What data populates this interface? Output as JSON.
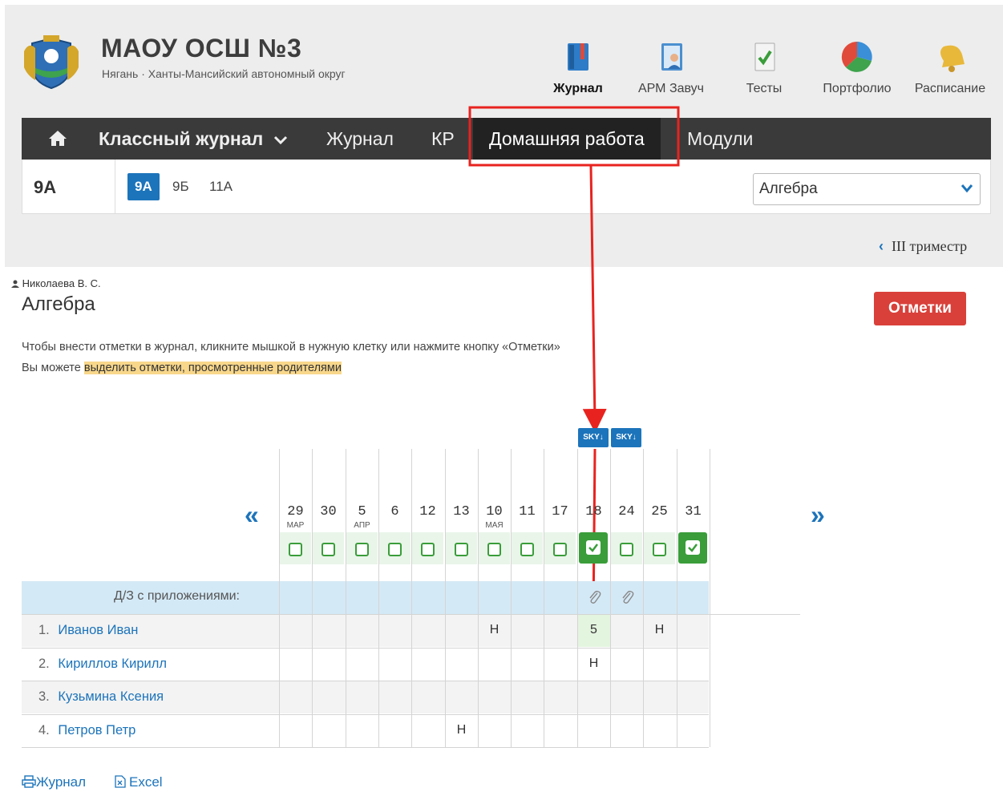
{
  "school": {
    "name": "МАОУ ОСШ №3",
    "subtitle": "Нягань · Ханты-Мансийский автономный округ"
  },
  "topnav": [
    {
      "label": "Журнал",
      "icon": "journal-icon",
      "active": true
    },
    {
      "label": "АРМ Завуч",
      "icon": "deputy-icon"
    },
    {
      "label": "Тесты",
      "icon": "tests-icon"
    },
    {
      "label": "Портфолио",
      "icon": "portfolio-icon"
    },
    {
      "label": "Расписание",
      "icon": "bell-icon"
    }
  ],
  "menu": {
    "home_icon": "home-icon",
    "class_journal": "Классный журнал",
    "journal": "Журнал",
    "kr": "КР",
    "homework": "Домашняя работа",
    "modules": "Модули"
  },
  "classbar": {
    "current": "9А",
    "classes": [
      "9А",
      "9Б",
      "11А"
    ],
    "subject": "Алгебра"
  },
  "term": "III триместр",
  "content": {
    "teacher": "Николаева В. С.",
    "title": "Алгебра",
    "marks_button": "Отметки",
    "hint1": "Чтобы внести отметки в журнал, кликните мышкой в нужную клетку или нажмите кнопку «Отметки»",
    "hint2_prefix": "Вы можете ",
    "hint2_link": "выделить отметки, просмотренные родителями"
  },
  "grid": {
    "sky_label": "SKY↓",
    "attach_label": "Д/З с приложениями:",
    "dates": [
      {
        "day": "29",
        "month": "МАР"
      },
      {
        "day": "30",
        "month": ""
      },
      {
        "day": "5",
        "month": "АПР"
      },
      {
        "day": "6",
        "month": ""
      },
      {
        "day": "12",
        "month": ""
      },
      {
        "day": "13",
        "month": ""
      },
      {
        "day": "10",
        "month": "МАЯ"
      },
      {
        "day": "11",
        "month": ""
      },
      {
        "day": "17",
        "month": ""
      },
      {
        "day": "18",
        "month": ""
      },
      {
        "day": "24",
        "month": ""
      },
      {
        "day": "25",
        "month": ""
      },
      {
        "day": "31",
        "month": ""
      }
    ],
    "students": [
      {
        "num": "1.",
        "name": "Иванов Иван",
        "marks": [
          "",
          "",
          "",
          "",
          "",
          "",
          "Н",
          "",
          "",
          "5",
          "",
          "Н",
          ""
        ]
      },
      {
        "num": "2.",
        "name": "Кириллов Кирилл",
        "marks": [
          "",
          "",
          "",
          "",
          "",
          "",
          "",
          "",
          "",
          "Н",
          "",
          "",
          ""
        ]
      },
      {
        "num": "3.",
        "name": "Кузьмина Ксения",
        "marks": [
          "",
          "",
          "",
          "",
          "",
          "",
          "",
          "",
          "",
          "",
          "",
          "",
          ""
        ]
      },
      {
        "num": "4.",
        "name": "Петров Петр",
        "marks": [
          "",
          "",
          "",
          "",
          "",
          "Н",
          "",
          "",
          "",
          "",
          "",
          "",
          ""
        ]
      }
    ]
  },
  "footer": {
    "journal": "Журнал",
    "excel": "Excel"
  },
  "colors": {
    "accent": "#1c74bb",
    "danger": "#d9403a",
    "success": "#3a9d3a",
    "highlight": "#f8d78b",
    "annotation": "#e8231f"
  }
}
